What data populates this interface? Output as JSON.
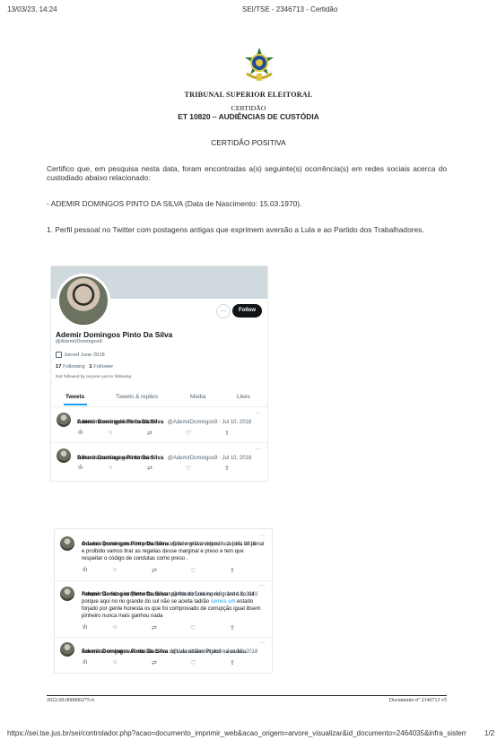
{
  "browser_header": {
    "datetime": "13/03/23, 14:24",
    "page_title": "SEI/TSE - 2346713 - Certidão"
  },
  "document": {
    "court": "TRIBUNAL SUPERIOR ELEITORAL",
    "doc_type": "CERTIDÃO",
    "subtitle": "ET 10820 – AUDIÊNCIAS DE CUSTÓDIA",
    "heading": "CERTIDÃO POSITIVA",
    "paragraph": "Certifico que, em pesquisa nesta data, foram encontradas a(s) seguinte(s) ocorrência(s) em redes sociais acerca do custodiado abaixo relacionado:",
    "person": "- ADEMIR DOMINGOS PINTO DA SILVA (Data de Nascimento: 15.03.1970).",
    "item1": "1. Perfil pessoal no Twitter com postagens antigas que exprimem aversão a Lula e ao Partido dos Trabalhadores."
  },
  "profile": {
    "name": "Ademir Domingos Pinto Da Silva",
    "handle": "@AdemirDomingos9",
    "joined": "Joined June 2018",
    "following_count": "17",
    "following_label": "Following",
    "followers_count": "1",
    "followers_label": "Follower",
    "not_followed": "Not followed by anyone you're following",
    "follow_button": "Follow",
    "more_button": "···",
    "tabs": [
      "Tweets",
      "Tweets & replies",
      "Media",
      "Likes"
    ]
  },
  "tweets_top": [
    {
      "name": "Ademir Domingos Pinto Da Silva",
      "meta": "@AdemirDomingos9 · Jul 10, 2018",
      "text": "Cadeia nesses politicos bandidos"
    },
    {
      "name": "Ademir Domingos Pinto Da Silva",
      "meta": "@AdemirDomingos9 · Jul 10, 2018",
      "text": "Dilma na cadeia e geisi também"
    }
  ],
  "tweets_bottom": [
    {
      "name": "Ademir Domingos Pinto Da Silva",
      "meta": "@AdemirDomingos9 · Jul 10, 2018",
      "lines": [
        "O Lula e preso como um preso tem celular e grava videos isso pela lei penal",
        "e proibido vamos tirar as regalias desse marginal e preso e tem que",
        "respeitar o código de condutas como preso ."
      ]
    },
    {
      "name": "Ademir Domingos Pinto Da Silva",
      "meta": "@AdemirDomingos9 · Jun 13, 2018",
      "lines": [
        "Porque não faz a lançamento da campanha do Lula no rio grande do sul",
        "porque aqui no rio grande do sul não se aceita ladrão",
        "forjado por gente honesta os que foi comprovado de corrupção igual ibsem",
        "pinheiro nunca mais ganhou nada"
      ],
      "link": "somos um",
      "link_suffix": " estado"
    },
    {
      "name": "Ademir Domingos Pinto Da Silva",
      "meta": "@AdemirDomingos9 · Jun 13, 2018",
      "lines": [
        "Em minas ninguém vai nos discurso do Lula abaixo Pt dos na cadeia"
      ]
    }
  ],
  "tweet_actions": {
    "stats": "ılı",
    "reply": "○",
    "retweet": "⇄",
    "like": "♡",
    "share": "⇪"
  },
  "footer": {
    "left": "2022.00.000000275-6",
    "right": "Documento nº 2346713 v5"
  },
  "url_bar": {
    "url": "https://sei.tse.jus.br/sei/controlador.php?acao=documento_imprimir_web&acao_origem=arvore_visualizar&id_documento=2464035&infra_sistem...",
    "page": "1/2"
  },
  "colors": {
    "twitter_blue": "#1d9bf0",
    "banner": "#cfd9de",
    "follow_bg": "#0f1419"
  },
  "icons": [
    "brasao-emblem",
    "calendar-icon",
    "more-icon",
    "stats-icon",
    "reply-icon",
    "retweet-icon",
    "like-icon",
    "share-icon"
  ]
}
